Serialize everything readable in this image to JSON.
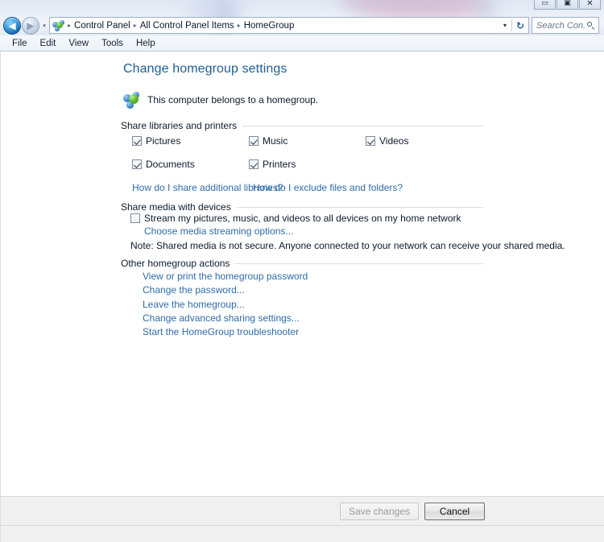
{
  "window": {
    "controls": [
      {
        "name": "minimize",
        "glyph": "▭"
      },
      {
        "name": "maximize",
        "glyph": "▣"
      },
      {
        "name": "close",
        "glyph": "✕"
      }
    ]
  },
  "navigation": {
    "back_glyph": "◀",
    "forward_glyph": "▶",
    "recent_pages_glyph": "▾",
    "breadcrumb_icon": "homegroup-icon",
    "breadcrumbs": [
      "Control Panel",
      "All Control Panel Items",
      "HomeGroup"
    ],
    "separator": "▸",
    "address_chevron": "▾",
    "refresh_glyph": "↻"
  },
  "search": {
    "placeholder": "Search Con...",
    "icon": "search-icon"
  },
  "menubar": {
    "items": [
      "File",
      "Edit",
      "View",
      "Tools",
      "Help"
    ]
  },
  "page": {
    "title": "Change homegroup settings",
    "status": "This computer belongs to a homegroup."
  },
  "sections": {
    "libraries": {
      "heading": "Share libraries and printers",
      "checkboxes": [
        {
          "label": "Pictures",
          "checked": true
        },
        {
          "label": "Music",
          "checked": true
        },
        {
          "label": "Videos",
          "checked": true
        },
        {
          "label": "Documents",
          "checked": true
        },
        {
          "label": "Printers",
          "checked": true
        }
      ],
      "links": [
        "How do I share additional libraries?",
        "How do I exclude files and folders?"
      ]
    },
    "media": {
      "heading": "Share media with devices",
      "stream_checkbox": {
        "label": "Stream my pictures, music, and videos to all devices on my home network",
        "checked": false
      },
      "streaming_link": "Choose media streaming options...",
      "note": "Note: Shared media is not secure. Anyone connected to your network can receive your shared media."
    },
    "other_actions": {
      "heading": "Other homegroup actions",
      "links": [
        "View or print the homegroup password",
        "Change the password...",
        "Leave the homegroup...",
        "Change advanced sharing settings...",
        "Start the HomeGroup troubleshooter"
      ]
    }
  },
  "buttons": {
    "save": {
      "label": "Save changes",
      "enabled": false
    },
    "cancel": {
      "label": "Cancel",
      "enabled": true
    }
  },
  "colors": {
    "heading": "#1f5f94",
    "link": "#2f6ca8",
    "text": "#0c1b2c"
  }
}
